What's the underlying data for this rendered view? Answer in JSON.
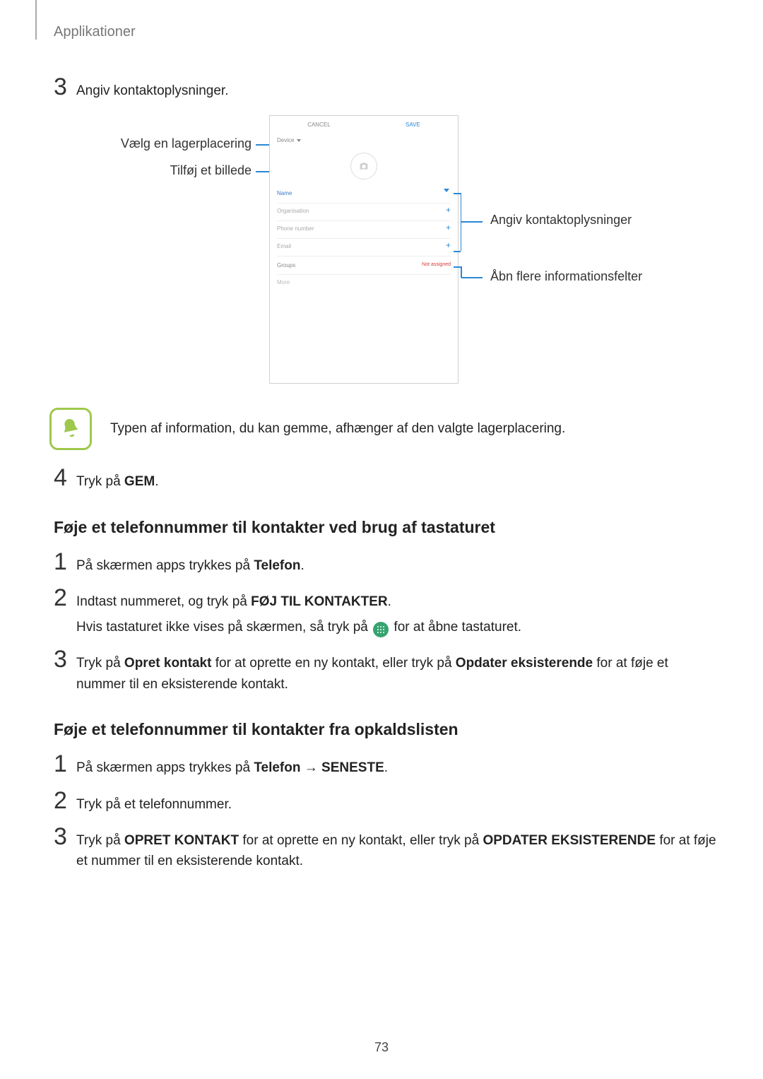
{
  "header": "Applikationer",
  "page_number": "73",
  "stepA": {
    "num": "3",
    "text": "Angiv kontaktoplysninger."
  },
  "diagram": {
    "left_callout_1": "Vælg en lagerplacering",
    "left_callout_2": "Tilføj et billede",
    "right_callout_1": "Angiv kontaktoplysninger",
    "right_callout_2": "Åbn flere informationsfelter",
    "phone": {
      "cancel": "CANCEL",
      "save": "SAVE",
      "device": "Device",
      "name": "Name",
      "org": "Organisation",
      "phone": "Phone number",
      "email": "Email",
      "groups": "Groups",
      "not_assigned": "Not assigned",
      "more": "More"
    }
  },
  "note": "Typen af information, du kan gemme, afhænger af den valgte lagerplacering.",
  "stepB": {
    "num": "4",
    "pre": "Tryk på ",
    "bold": "GEM",
    "post": "."
  },
  "heading1": "Føje et telefonnummer til kontakter ved brug af tastaturet",
  "sec1": {
    "s1": {
      "num": "1",
      "pre": "På skærmen apps trykkes på ",
      "bold": "Telefon",
      "post": "."
    },
    "s2": {
      "num": "2",
      "l1_pre": "Indtast nummeret, og tryk på ",
      "l1_bold": "FØJ TIL KONTAKTER",
      "l1_post": ".",
      "l2_pre": "Hvis tastaturet ikke vises på skærmen, så tryk på ",
      "l2_post": " for at åbne tastaturet."
    },
    "s3": {
      "num": "3",
      "t1": "Tryk på ",
      "b1": "Opret kontakt",
      "t2": " for at oprette en ny kontakt, eller tryk på ",
      "b2": "Opdater eksisterende",
      "t3": " for at føje et nummer til en eksisterende kontakt."
    }
  },
  "heading2": "Føje et telefonnummer til kontakter fra opkaldslisten",
  "sec2": {
    "s1": {
      "num": "1",
      "pre": "På skærmen apps trykkes på ",
      "b1": "Telefon",
      "arrow": " → ",
      "b2": "SENESTE",
      "post": "."
    },
    "s2": {
      "num": "2",
      "text": "Tryk på et telefonnummer."
    },
    "s3": {
      "num": "3",
      "t1": "Tryk på ",
      "b1": "OPRET KONTAKT",
      "t2": " for at oprette en ny kontakt, eller tryk på ",
      "b2": "OPDATER EKSISTERENDE",
      "t3": " for at føje et nummer til en eksisterende kontakt."
    }
  }
}
